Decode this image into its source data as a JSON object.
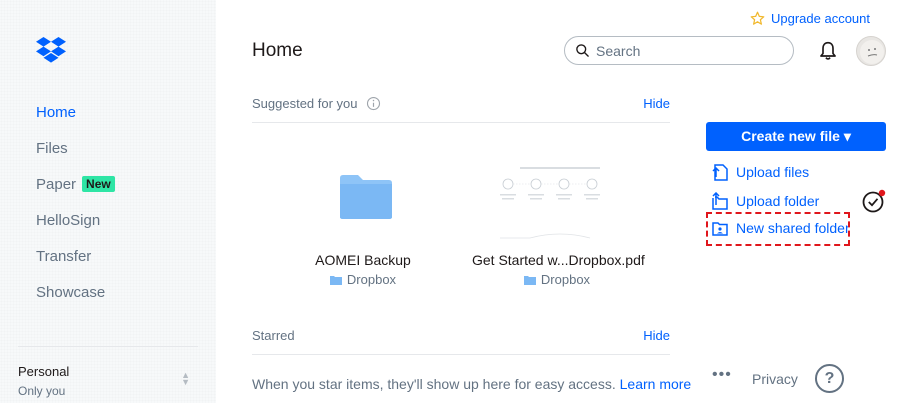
{
  "sidebar": {
    "nav": [
      {
        "label": "Home"
      },
      {
        "label": "Files"
      },
      {
        "label": "Paper",
        "badge": "New"
      },
      {
        "label": "HelloSign"
      },
      {
        "label": "Transfer"
      },
      {
        "label": "Showcase"
      }
    ],
    "account": {
      "name": "Personal",
      "sub": "Only you"
    }
  },
  "header": {
    "upgrade": "Upgrade account",
    "title": "Home",
    "search_placeholder": "Search"
  },
  "suggested": {
    "label": "Suggested for you",
    "hide": "Hide",
    "items": [
      {
        "title": "AOMEI Backup",
        "location": "Dropbox"
      },
      {
        "title": "Get Started w...Dropbox.pdf",
        "location": "Dropbox"
      }
    ]
  },
  "starred": {
    "label": "Starred",
    "hide": "Hide",
    "empty_text": "When you star items, they'll show up here for easy access.",
    "learn_more": "Learn more"
  },
  "actions": {
    "create": "Create new file ▾",
    "upload_files": "Upload files",
    "upload_folder": "Upload folder",
    "new_shared_folder": "New shared folder"
  },
  "footer": {
    "more": "•••",
    "privacy": "Privacy",
    "help": "?"
  },
  "colors": {
    "accent": "#0061fe",
    "badge": "#2ee5a5",
    "highlight_dash": "#e0161c"
  }
}
